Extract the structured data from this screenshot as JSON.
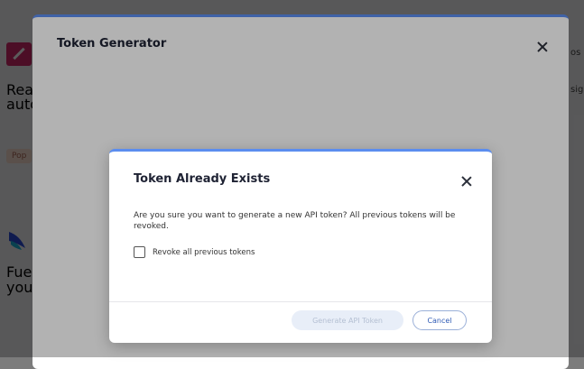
{
  "background": {
    "left_card_1_text": [
      "Reac",
      "auto"
    ],
    "left_card_1_pill": "Pop",
    "left_card_2_text": [
      "Fuel",
      "your"
    ],
    "right_fragments": [
      "os",
      "sig"
    ]
  },
  "outer_modal": {
    "title": "Token Generator",
    "close_icon": "close-icon"
  },
  "dialog": {
    "title": "Token Already Exists",
    "message": "Are you sure you want to generate a new API token? All previous tokens will be revoked.",
    "checkbox_label": "Revoke all previous tokens",
    "checkbox_checked": false,
    "generate_label": "Generate API Token",
    "cancel_label": "Cancel",
    "close_icon": "close-icon"
  },
  "colors": {
    "accent": "#5b8def",
    "primary_button_disabled": "#e8eef8",
    "cancel_text": "#2f5bb5"
  }
}
